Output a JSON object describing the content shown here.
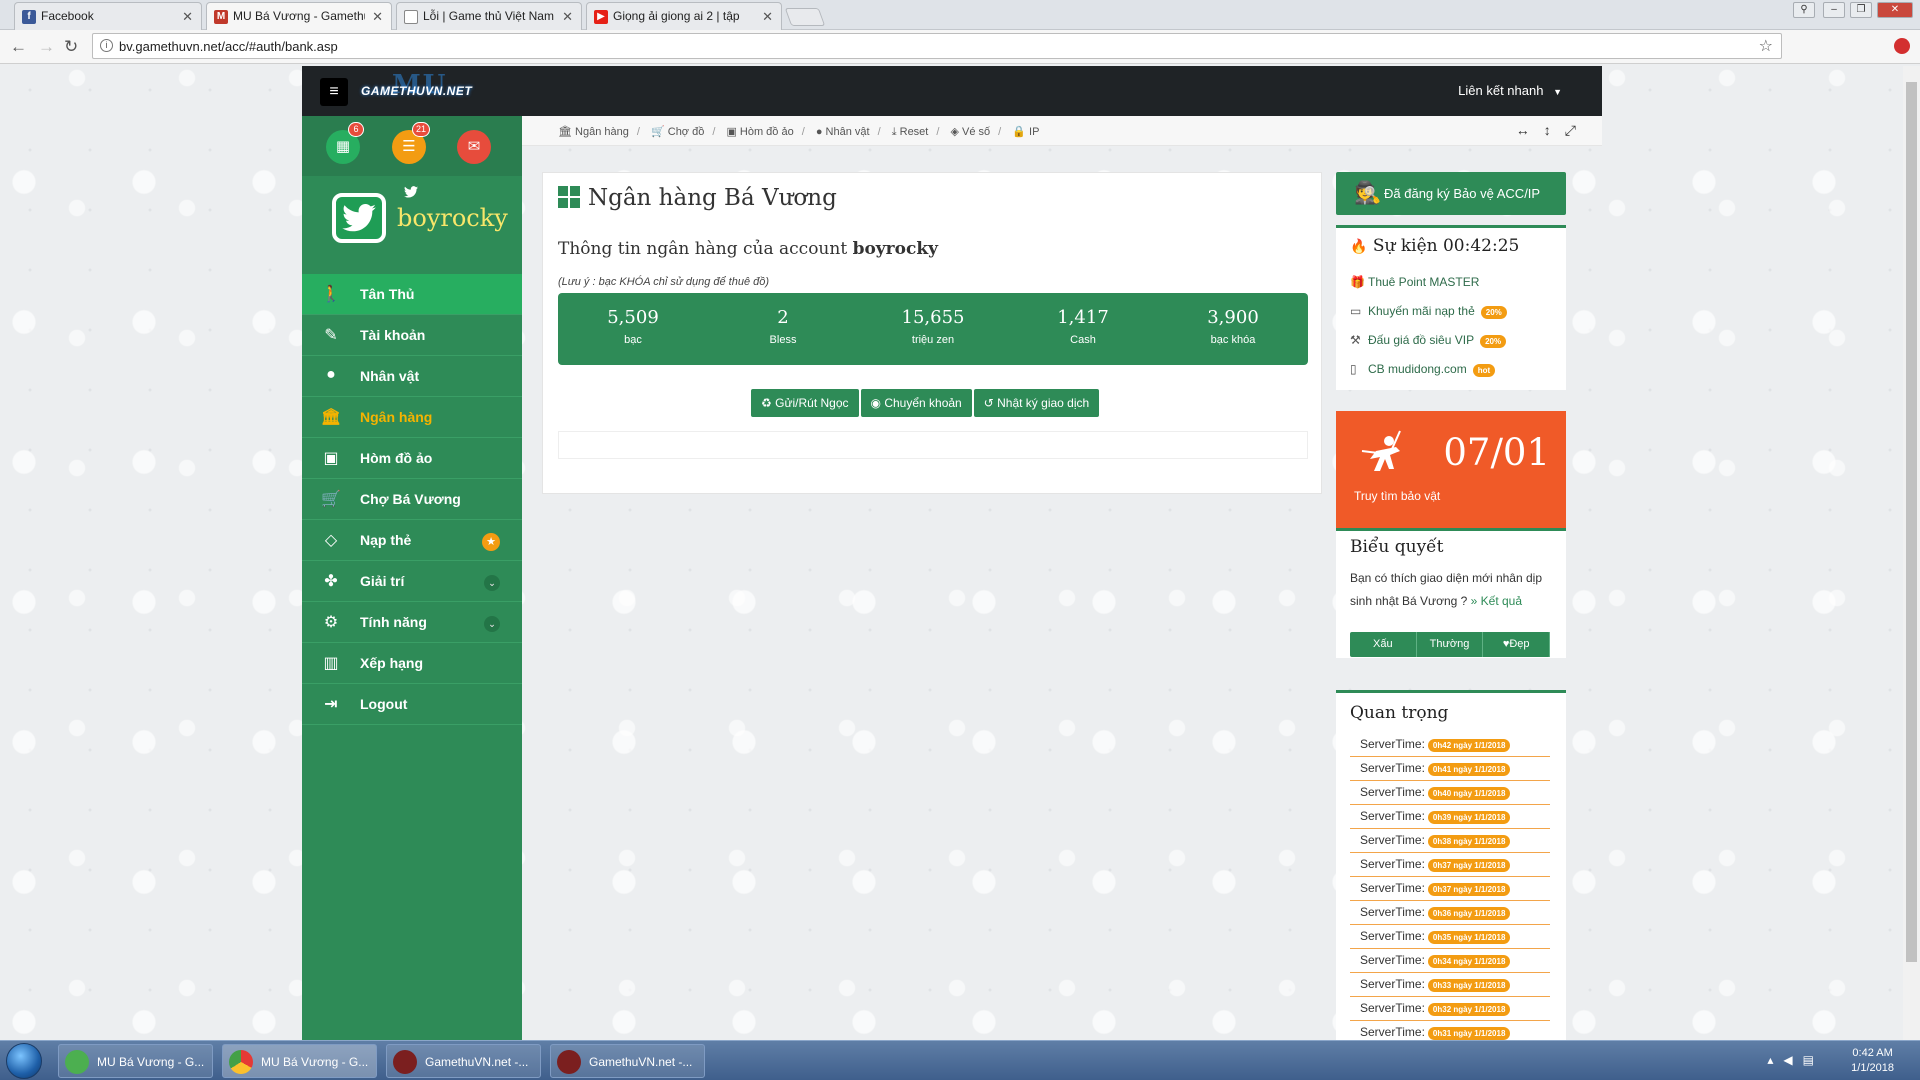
{
  "browser": {
    "tabs": [
      {
        "title": "Facebook",
        "icon": "facebook-icon",
        "active": false
      },
      {
        "title": "MU Bá Vương - Gamethu",
        "icon": "mu-icon",
        "active": true
      },
      {
        "title": "Lỗi | Game thủ Việt Nam",
        "icon": "page-icon",
        "active": false
      },
      {
        "title": "Giọng ải giong ai 2 | tập",
        "icon": "youtube-icon",
        "active": false
      }
    ],
    "url": "bv.gamethuvn.net/acc/#auth/bank.asp"
  },
  "topnav": {
    "logo_text": "GAMETHUVN.NET",
    "logo_mark": "MU",
    "quick_link": "Liên kết nhanh"
  },
  "sidebar": {
    "badges": {
      "calendar": "6",
      "list": "21"
    },
    "username": "boyrocky",
    "items": [
      {
        "label": "Tân Thủ",
        "icon": "man-icon"
      },
      {
        "label": "Tài khoản",
        "icon": "edit-icon"
      },
      {
        "label": "Nhân vật",
        "icon": "user-icon"
      },
      {
        "label": "Ngân hàng",
        "icon": "bank-icon"
      },
      {
        "label": "Hòm đồ ảo",
        "icon": "briefcase-icon"
      },
      {
        "label": "Chợ Bá Vương",
        "icon": "cart-icon"
      },
      {
        "label": "Nạp thẻ",
        "icon": "diamond-icon"
      },
      {
        "label": "Giải trí",
        "icon": "android-icon"
      },
      {
        "label": "Tính năng",
        "icon": "cogs-icon"
      },
      {
        "label": "Xếp hạng",
        "icon": "bar-chart-icon"
      },
      {
        "label": "Logout",
        "icon": "logout-icon"
      }
    ]
  },
  "breadcrumb": [
    "Ngân hàng",
    "Chợ đồ",
    "Hòm đồ ảo",
    "Nhân vật",
    "Reset",
    "Vé số",
    "IP"
  ],
  "main": {
    "title": "Ngân hàng Bá Vương",
    "account_prefix": "Thông tin ngân hàng của account",
    "account_name": "boyrocky",
    "note": "(Lưu ý : bạc KHÓA chỉ sử dụng để thuê đồ)",
    "stats": [
      {
        "value": "5,509",
        "label": "bạc"
      },
      {
        "value": "2",
        "label": "Bless"
      },
      {
        "value": "15,655",
        "label": "triệu zen"
      },
      {
        "value": "1,417",
        "label": "Cash"
      },
      {
        "value": "3,900",
        "label": "bạc khóa"
      }
    ],
    "buttons": [
      "Gửi/Rút Ngọc",
      "Chuyển khoản",
      "Nhật ký giao dịch"
    ]
  },
  "right": {
    "protect_label": "Đã đăng ký Bảo vệ ACC/IP",
    "event_title": "Sự kiện 00:42:25",
    "events": [
      {
        "label": "Thuê Point MASTER",
        "tag": "",
        "icon": "gift-icon"
      },
      {
        "label": "Khuyến mãi nạp thẻ",
        "tag": "20%",
        "icon": "money-icon"
      },
      {
        "label": "Đấu giá đồ siêu VIP",
        "tag": "20%",
        "icon": "gavel-icon"
      },
      {
        "label": "CB mudidong.com",
        "tag": "hot",
        "icon": "mobile-icon"
      }
    ],
    "treasure_date": "07/01",
    "treasure_label": "Truy tìm bảo vật",
    "poll_title": "Biểu quyết",
    "poll_question": "Bạn có thích giao diện mới nhân dịp sinh nhật Bá Vương ?",
    "poll_result_link": "» Kết quả",
    "poll_options": [
      "Xấu",
      "Thường",
      "Đẹp"
    ],
    "important_title": "Quan trọng",
    "server_label": "ServerTime:",
    "server_times": [
      "0h42 ngày 1/1/2018",
      "0h41 ngày 1/1/2018",
      "0h40 ngày 1/1/2018",
      "0h39 ngày 1/1/2018",
      "0h38 ngày 1/1/2018",
      "0h37 ngày 1/1/2018",
      "0h37 ngày 1/1/2018",
      "0h36 ngày 1/1/2018",
      "0h35 ngày 1/1/2018",
      "0h34 ngày 1/1/2018",
      "0h33 ngày 1/1/2018",
      "0h32 ngày 1/1/2018",
      "0h31 ngày 1/1/2018"
    ]
  },
  "taskbar": {
    "items": [
      "MU Bá Vương - G...",
      "MU Bá Vương - G...",
      "GamethuVN.net -...",
      "GamethuVN.net -..."
    ],
    "time": "0:42 AM",
    "date": "1/1/2018"
  },
  "colors": {
    "sidebar_green": "#2e8b57",
    "accent_orange": "#f39c12",
    "treasure_orange": "#f05a28",
    "topbar": "#1f2326"
  }
}
